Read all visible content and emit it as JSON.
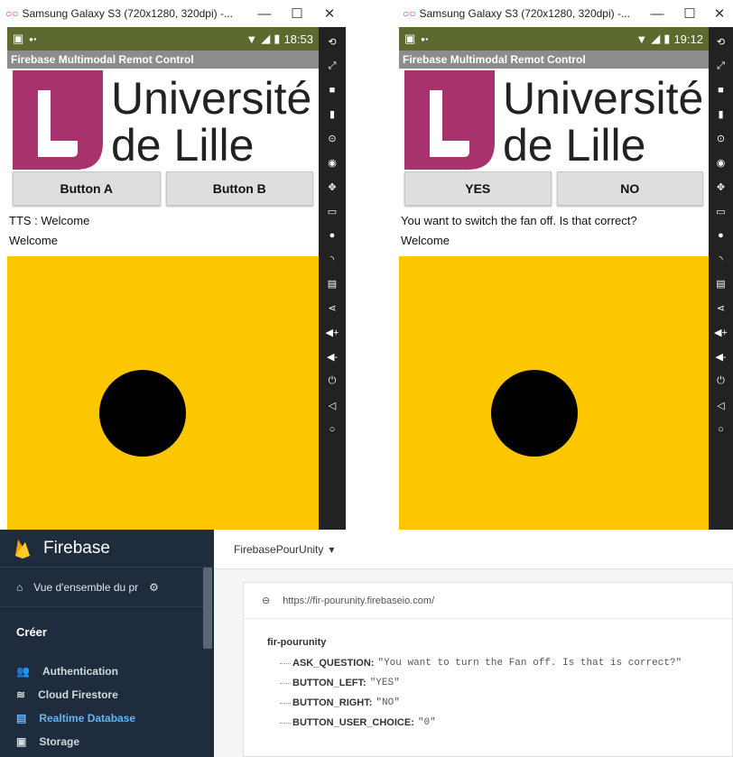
{
  "emulator_left": {
    "window_title": "Samsung Galaxy S3 (720x1280, 320dpi) -...",
    "status_time": "18:53",
    "app_title": "Firebase Multimodal Remot Control",
    "logo_line1": "Université",
    "logo_line2": "de Lille",
    "button_left": "Button A",
    "button_right": "Button B",
    "text_line1": "TTS : Welcome",
    "text_line2": "Welcome"
  },
  "emulator_right": {
    "window_title": "Samsung Galaxy S3 (720x1280, 320dpi) -...",
    "status_time": "19:12",
    "app_title": "Firebase Multimodal Remot Control",
    "logo_line1": "Université",
    "logo_line2": "de Lille",
    "button_left": "YES",
    "button_right": "NO",
    "text_line1": "You want to switch the fan off. Is that correct?",
    "text_line2": "Welcome"
  },
  "window_controls": {
    "minimize": "—",
    "maximize": "☐",
    "close": "✕"
  },
  "sidebar_icons": [
    "rotate-icon",
    "resize-icon",
    "camera-icon",
    "battery-icon",
    "gps-icon",
    "webcam-icon",
    "dpad-icon",
    "id-icon",
    "media-icon",
    "rss-icon",
    "sms-icon",
    "opengapps-icon",
    "share-icon",
    "volume-up-icon",
    "volume-down-icon",
    "power-icon",
    "back-icon",
    "home-icon"
  ],
  "firebase": {
    "brand": "Firebase",
    "project_name": "FirebasePourUnity",
    "overview_label": "Vue d'ensemble du pr",
    "section_label": "Créer",
    "nav_items": [
      {
        "label": "Authentication",
        "icon": "people-icon"
      },
      {
        "label": "Cloud Firestore",
        "icon": "firestore-icon"
      },
      {
        "label": "Realtime Database",
        "icon": "database-icon"
      },
      {
        "label": "Storage",
        "icon": "image-icon"
      }
    ],
    "db_url": "https://fir-pourunity.firebaseio.com/",
    "db_root": "fir-pourunity",
    "entries": [
      {
        "key": "ASK_QUESTION:",
        "value": "\"You want to turn the Fan off. Is that is correct?\""
      },
      {
        "key": "BUTTON_LEFT:",
        "value": "\"YES\""
      },
      {
        "key": "BUTTON_RIGHT:",
        "value": "\"NO\""
      },
      {
        "key": "BUTTON_USER_CHOICE:",
        "value": "\"0\""
      }
    ]
  },
  "colors": {
    "status_bar": "#5d6a2f",
    "app_bar": "#8c8c8c",
    "yellow": "#fcc600",
    "logo_magenta": "#a8326e",
    "firebase_nav": "#1f2c3d",
    "active_blue": "#64b5f6"
  }
}
